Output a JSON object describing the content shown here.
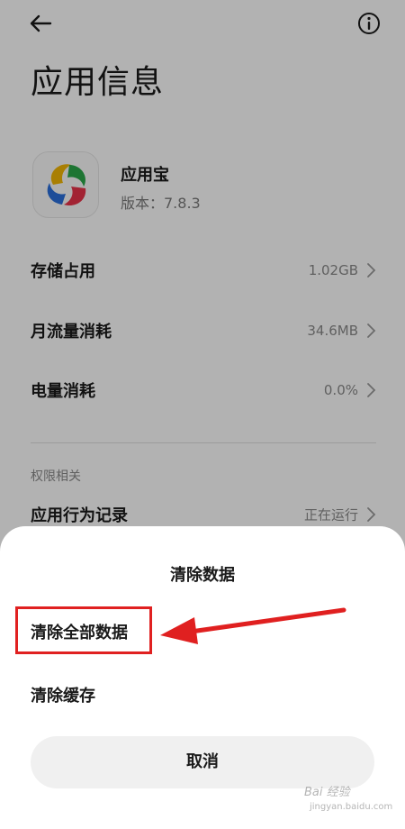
{
  "page": {
    "title": "应用信息"
  },
  "app": {
    "name": "应用宝",
    "version": "版本：7.8.3",
    "icon": "app-store-logo"
  },
  "settings": [
    {
      "label": "存储占用",
      "value": "1.02GB"
    },
    {
      "label": "月流量消耗",
      "value": "34.6MB"
    },
    {
      "label": "电量消耗",
      "value": "0.0%"
    }
  ],
  "permissions": {
    "section_label": "权限相关",
    "behavior_label": "应用行为记录",
    "behavior_value": "正在运行"
  },
  "sheet": {
    "title": "清除数据",
    "clear_all_label": "清除全部数据",
    "clear_cache_label": "清除缓存",
    "cancel_label": "取消"
  },
  "annotation": {
    "color": "#e02020"
  },
  "watermark": {
    "text": "Bai 经验",
    "sub": "jingyan.baidu.com"
  }
}
